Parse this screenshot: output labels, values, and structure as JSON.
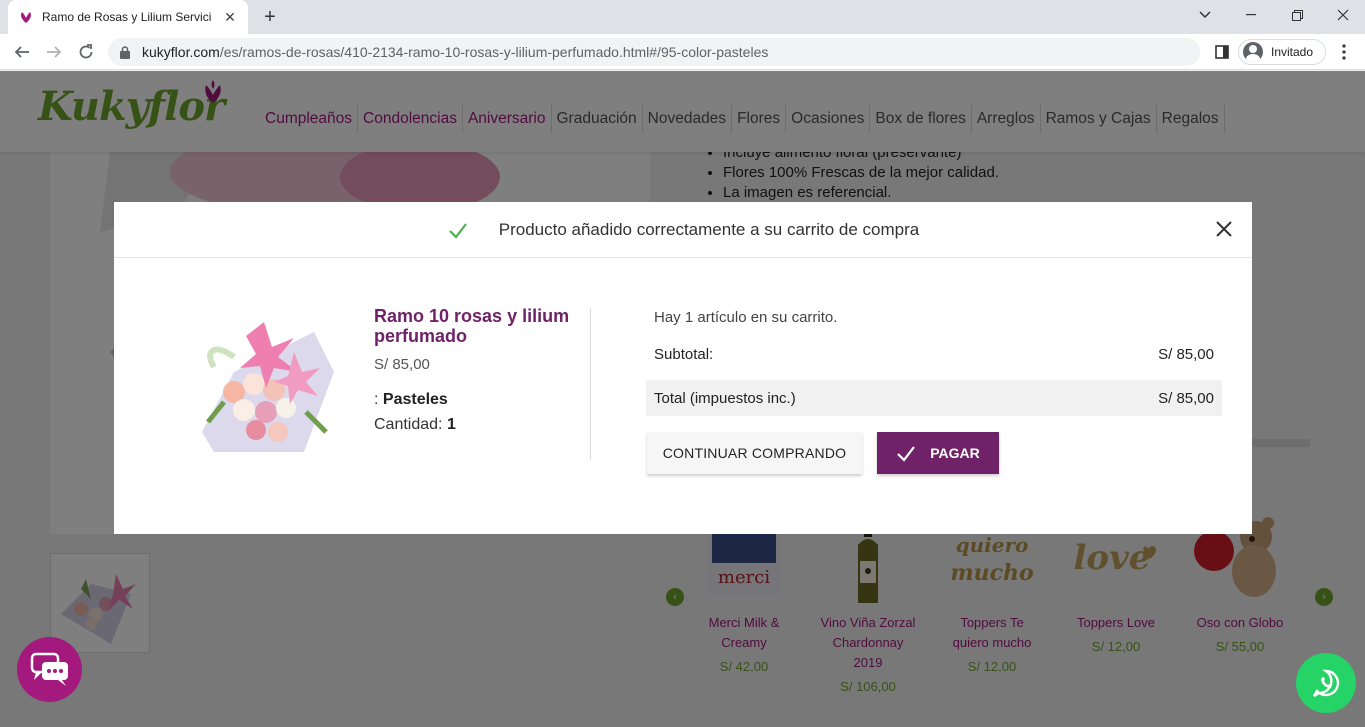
{
  "browser": {
    "tab_title": "Ramo de Rosas y Lilium Servicio",
    "url_host": "kukyflor.com",
    "url_path": "/es/ramos-de-rosas/410-2134-ramo-10-rosas-y-lilium-perfumado.html#/95-color-pasteles",
    "profile_label": "Invitado"
  },
  "site": {
    "logo": "Kukyflor",
    "nav": [
      {
        "label": "Cumpleaños",
        "highlight": true
      },
      {
        "label": "Condolencias",
        "highlight": true
      },
      {
        "label": "Aniversario",
        "highlight": true
      },
      {
        "label": "Graduación",
        "highlight": false
      },
      {
        "label": "Novedades",
        "highlight": false
      },
      {
        "label": "Flores",
        "highlight": false
      },
      {
        "label": "Ocasiones",
        "highlight": false
      },
      {
        "label": "Box de flores",
        "highlight": false
      },
      {
        "label": "Arreglos",
        "highlight": false
      },
      {
        "label": "Ramos y Cajas",
        "highlight": false
      },
      {
        "label": "Regalos",
        "highlight": false
      }
    ],
    "bullets": [
      "Incluye alimento floral (preservante)",
      "Flores 100% Frescas de la mejor calidad.",
      "La imagen es referencial."
    ],
    "related": [
      {
        "name": "Merci Milk & Creamy",
        "price": "S/ 42,00",
        "img_label": "merci"
      },
      {
        "name": "Vino Viña Zorzal Chardonnay 2019",
        "price": "S/ 106,00",
        "img_label": ""
      },
      {
        "name": "Toppers Te quiero mucho",
        "price": "S/ 12,00",
        "img_label": "quiero mucho"
      },
      {
        "name": "Toppers Love",
        "price": "S/ 12,00",
        "img_label": "love"
      },
      {
        "name": "Oso con Globo",
        "price": "S/ 55,00",
        "img_label": ""
      }
    ]
  },
  "modal": {
    "title": "Producto añadido correctamente a su carrito de compra",
    "product_name": "Ramo 10 rosas y lilium perfumado",
    "product_price": "S/ 85,00",
    "attr_prefix": ": ",
    "attr_value": "Pasteles",
    "qty_label": "Cantidad: ",
    "qty_value": "1",
    "cart_count": "Hay 1 artículo en su carrito.",
    "subtotal_label": "Subtotal:",
    "subtotal_value": "S/ 85,00",
    "total_label": "Total (impuestos inc.)",
    "total_value": "S/ 85,00",
    "continue_label": "CONTINUAR COMPRANDO",
    "pay_label": "PAGAR"
  },
  "colors": {
    "brand_purple": "#6f2268",
    "brand_magenta": "#a3197e",
    "brand_green": "#6fa52e",
    "whatsapp_green": "#25d366"
  }
}
